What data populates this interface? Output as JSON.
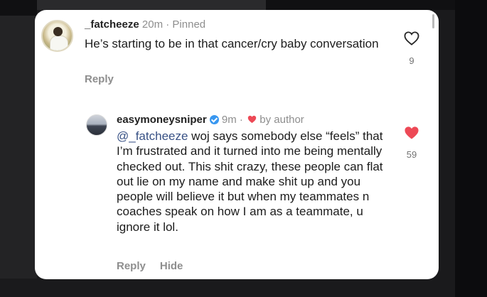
{
  "comments": [
    {
      "username": "_fatcheeze",
      "time": "20m",
      "status": "Pinned",
      "text": "He’s starting to be in that cancer/cry baby conversation",
      "reply_label": "Reply",
      "like_count": "9",
      "liked": false
    },
    {
      "username": "easymoneysniper",
      "verified": true,
      "time": "9m",
      "liked_by": "by author",
      "mention": "@_fatcheeze",
      "text": " woj says somebody else “feels” that I’m frustrated and it turned into me being mentally checked out. This shit crazy, these people can flat out lie on my name and make shit up and you people will believe it but when my teammates n coaches speak on how I am as a teammate, u ignore it lol.",
      "reply_label": "Reply",
      "hide_label": "Hide",
      "like_count": "59",
      "liked": true
    }
  ],
  "separator": "·",
  "colors": {
    "heart_red": "#ed4956",
    "verified_blue": "#3897f0",
    "mention_blue": "#385185",
    "meta_gray": "#8e8e8e"
  },
  "icons": {
    "like_outline": "heart-outline-icon",
    "like_filled": "heart-filled-icon",
    "verified": "verified-badge-icon"
  }
}
